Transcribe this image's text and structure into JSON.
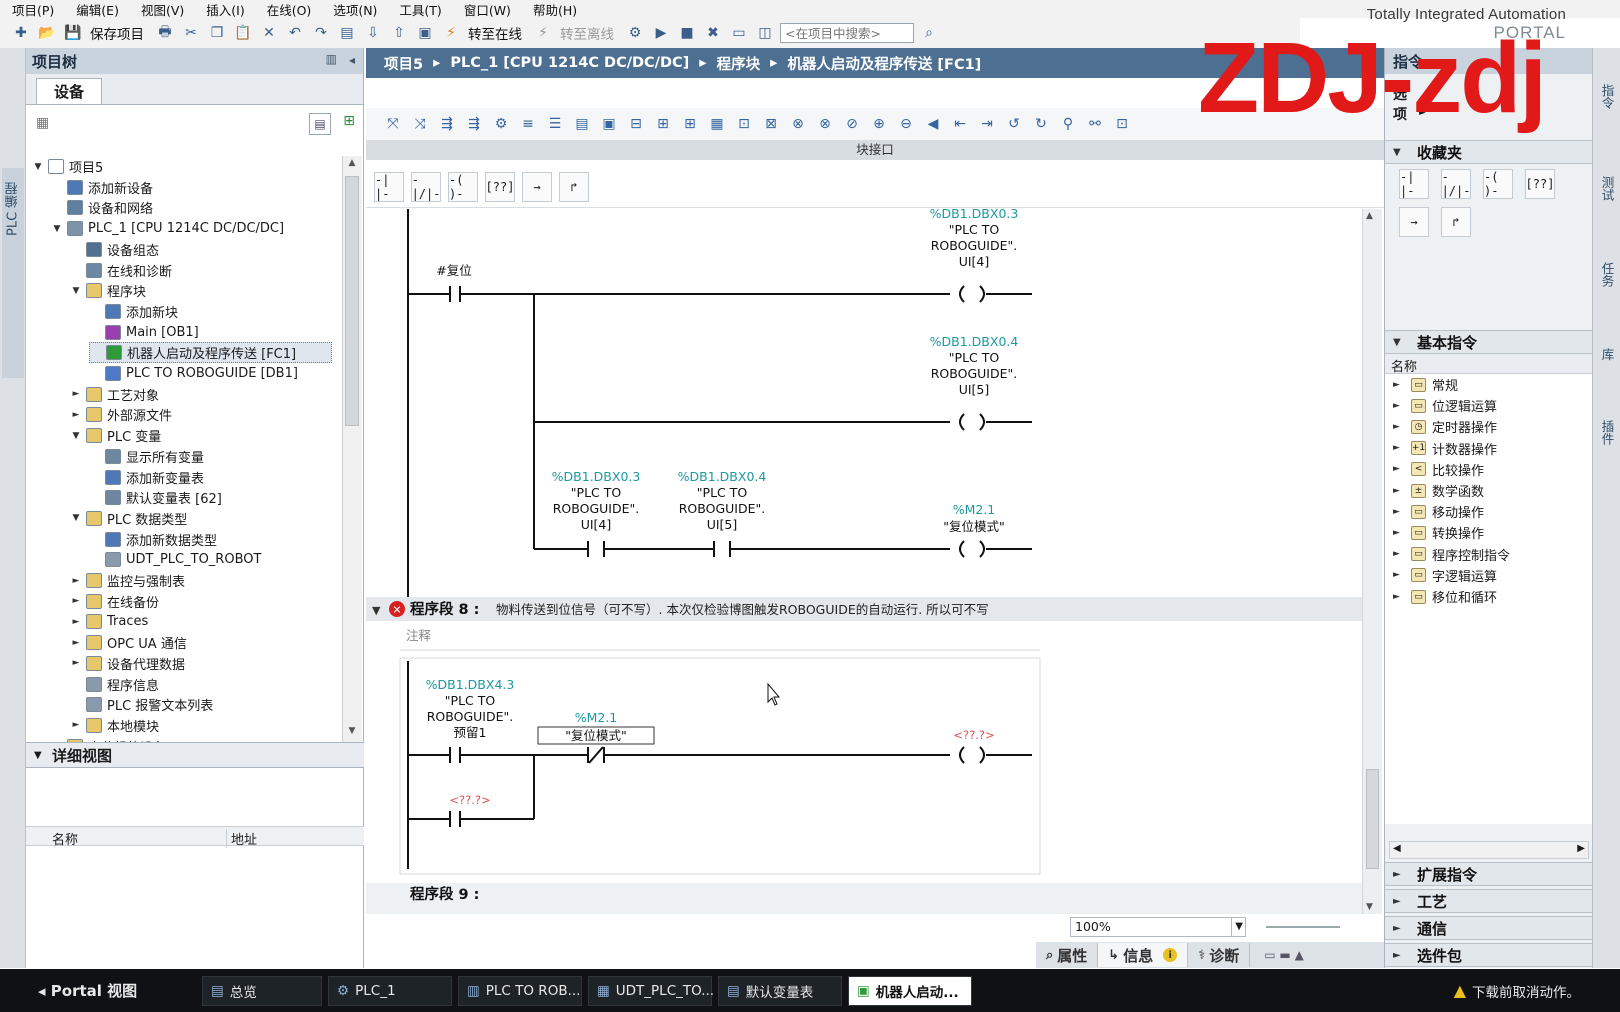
{
  "menu": [
    "项目(P)",
    "编辑(E)",
    "视图(V)",
    "插入(I)",
    "在线(O)",
    "选项(N)",
    "工具(T)",
    "窗口(W)",
    "帮助(H)"
  ],
  "brand": {
    "title": "Totally Integrated Automation",
    "subtitle": "PORTAL"
  },
  "toolbar": {
    "save_label": "保存项目",
    "go_online": "转至在线",
    "go_offline": "转至离线",
    "search_placeholder": "<在项目中搜索>"
  },
  "left_strip": {
    "label": "PLC 编程"
  },
  "tree": {
    "title": "项目树",
    "devices_tab": "设备",
    "items": [
      {
        "label": "项目5",
        "level": 0,
        "tw": "▼",
        "color": "#ffffff"
      },
      {
        "label": "添加新设备",
        "level": 1,
        "tw": "",
        "color": "#4f79b6"
      },
      {
        "label": "设备和网络",
        "level": 1,
        "tw": "",
        "color": "#5e7fa0"
      },
      {
        "label": "PLC_1 [CPU 1214C DC/DC/DC]",
        "level": 1,
        "tw": "▼",
        "color": "#7f93a8"
      },
      {
        "label": "设备组态",
        "level": 2,
        "tw": "",
        "color": "#52708f"
      },
      {
        "label": "在线和诊断",
        "level": 2,
        "tw": "",
        "color": "#6c88a5"
      },
      {
        "label": "程序块",
        "level": 2,
        "tw": "▼",
        "color": "#e6c76a"
      },
      {
        "label": "添加新块",
        "level": 3,
        "tw": "",
        "color": "#4f79b6"
      },
      {
        "label": "Main [OB1]",
        "level": 3,
        "tw": "",
        "color": "#9b3fb0"
      },
      {
        "label": "机器人启动及程序传送 [FC1]",
        "level": 3,
        "tw": "",
        "color": "#2f9a3a",
        "sel": true
      },
      {
        "label": "PLC TO ROBOGUIDE [DB1]",
        "level": 3,
        "tw": "",
        "color": "#4e79c7"
      },
      {
        "label": "工艺对象",
        "level": 2,
        "tw": "►",
        "color": "#e6c76a"
      },
      {
        "label": "外部源文件",
        "level": 2,
        "tw": "►",
        "color": "#e6c76a"
      },
      {
        "label": "PLC 变量",
        "level": 2,
        "tw": "▼",
        "color": "#e6c76a"
      },
      {
        "label": "显示所有变量",
        "level": 3,
        "tw": "",
        "color": "#6f86a0"
      },
      {
        "label": "添加新变量表",
        "level": 3,
        "tw": "",
        "color": "#4f79b6"
      },
      {
        "label": "默认变量表 [62]",
        "level": 3,
        "tw": "",
        "color": "#6f86a0"
      },
      {
        "label": "PLC 数据类型",
        "level": 2,
        "tw": "▼",
        "color": "#e6c76a"
      },
      {
        "label": "添加新数据类型",
        "level": 3,
        "tw": "",
        "color": "#4f79b6"
      },
      {
        "label": "UDT_PLC_TO_ROBOT",
        "level": 3,
        "tw": "",
        "color": "#8a9aac"
      },
      {
        "label": "监控与强制表",
        "level": 2,
        "tw": "►",
        "color": "#e6c76a"
      },
      {
        "label": "在线备份",
        "level": 2,
        "tw": "►",
        "color": "#e6c76a"
      },
      {
        "label": "Traces",
        "level": 2,
        "tw": "►",
        "color": "#e6c76a"
      },
      {
        "label": "OPC UA 通信",
        "level": 2,
        "tw": "►",
        "color": "#e6c76a"
      },
      {
        "label": "设备代理数据",
        "level": 2,
        "tw": "►",
        "color": "#e6c76a"
      },
      {
        "label": "程序信息",
        "level": 2,
        "tw": "",
        "color": "#8a9aac"
      },
      {
        "label": "PLC 报警文本列表",
        "level": 2,
        "tw": "",
        "color": "#8a9aac"
      },
      {
        "label": "本地模块",
        "level": 2,
        "tw": "►",
        "color": "#e6c76a"
      },
      {
        "label": "未分组的设备",
        "level": 1,
        "tw": "►",
        "color": "#e6c76a"
      }
    ],
    "detail_view": "详细视图",
    "col_name": "名称",
    "col_addr": "地址"
  },
  "editor": {
    "breadcrumb": [
      "项目5",
      "PLC_1 [CPU 1214C DC/DC/DC]",
      "程序块",
      "机器人启动及程序传送 [FC1]"
    ],
    "block_interface": "块接口",
    "fav_icons": [
      "-| |-",
      "-|/|-",
      "-( )-",
      "[??]",
      "→",
      "↱"
    ],
    "zoom": "100%"
  },
  "ladder": {
    "reset_label": "#复位",
    "coil1": {
      "addr": "%DB1.DBX0.3",
      "db": "\"PLC TO",
      "db2": "ROBOGUIDE\".",
      "member": "UI[4]"
    },
    "coil2": {
      "addr": "%DB1.DBX0.4",
      "db": "\"PLC TO",
      "db2": "ROBOGUIDE\".",
      "member": "UI[5]"
    },
    "c3a": {
      "addr": "%DB1.DBX0.3",
      "db": "\"PLC TO",
      "db2": "ROBOGUIDE\".",
      "member": "UI[4]"
    },
    "c3b": {
      "addr": "%DB1.DBX0.4",
      "db": "\"PLC TO",
      "db2": "ROBOGUIDE\".",
      "member": "UI[5]"
    },
    "coil3": {
      "addr": "%M2.1",
      "name": "\"复位模式\""
    },
    "network8": {
      "title": "程序段 8 :",
      "comment": "物料传送到位信号（可不写）. 本次仅检验博图触发ROBOGUIDE的自动运行. 所以可不写",
      "comment_label": "注释"
    },
    "n8c1": {
      "addr": "%DB1.DBX4.3",
      "db": "\"PLC TO",
      "db2": "ROBOGUIDE\".",
      "member": "预留1"
    },
    "n8c2": {
      "addr": "%M2.1",
      "name": "\"复位模式\""
    },
    "placeholder": "<??.?>",
    "network9": "程序段 9 :"
  },
  "status_tabs": {
    "props": "属性",
    "info": "信息",
    "diag": "诊断"
  },
  "right": {
    "title": "指令",
    "options": "选项",
    "favorites": "收藏夹",
    "basic": "基本指令",
    "name_col": "名称",
    "items": [
      "常规",
      "位逻辑运算",
      "定时器操作",
      "计数器操作",
      "比较操作",
      "数学函数",
      "移动操作",
      "转换操作",
      "程序控制指令",
      "字逻辑运算",
      "移位和循环"
    ],
    "item_icons": [
      "▭",
      "▭",
      "◷",
      "+1",
      "<",
      "±",
      "▭",
      "▭",
      "▭",
      "▭",
      "▭"
    ],
    "ext": "扩展指令",
    "tech": "工艺",
    "comm": "通信",
    "opt": "选件包"
  },
  "far_right": [
    "指令",
    "测试",
    "任务",
    "库",
    "插件"
  ],
  "taskbar": {
    "portal": "Portal 视图",
    "tasks": [
      "总览",
      "PLC_1",
      "PLC TO ROB...",
      "UDT_PLC_TO...",
      "默认变量表",
      "机器人启动..."
    ],
    "status": "下载前取消动作。"
  },
  "watermark": "ZDJ-zdj"
}
